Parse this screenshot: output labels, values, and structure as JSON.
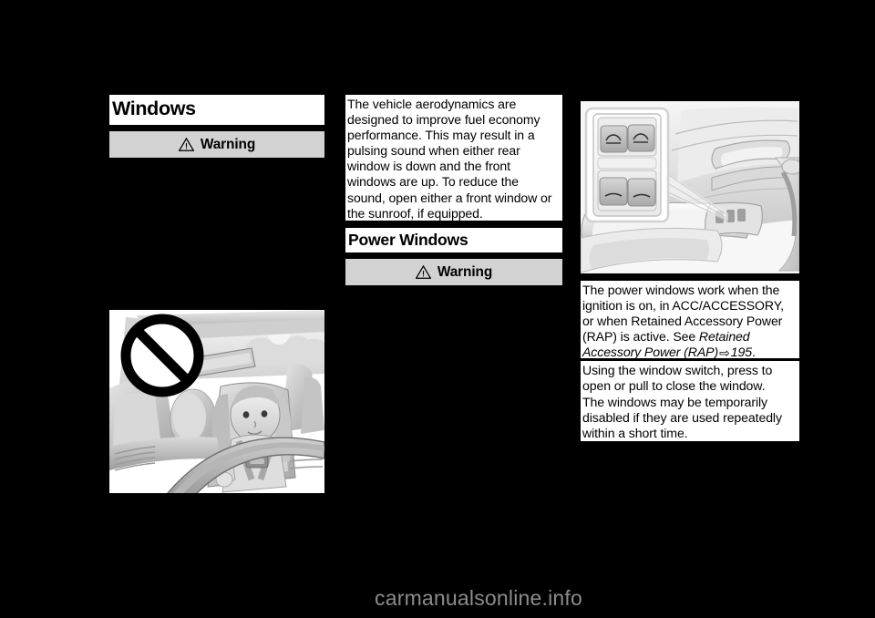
{
  "page": {
    "background_color": "#000000",
    "text_color": "#000000",
    "panel_color": "#ffffff",
    "warning_banner_color": "#d2d2d2",
    "footer_color": "#8c8c8c"
  },
  "left_column": {
    "section_title": "Windows",
    "warning_label": "Warning",
    "warning_icon": "warning-triangle-icon",
    "figure_caption": "",
    "figure_name": "child-in-car-seat-prohibited-illustration",
    "figure_alt": "Grayscale illustration of a vehicle interior showing a child seated in a child restraint in the front seat, overlaid with a circular prohibition (no) symbol"
  },
  "middle_column": {
    "paragraph": "The vehicle aerodynamics are designed to improve fuel economy performance. This may result in a pulsing sound when either rear window is down and the front windows are up. To reduce the sound, open either a front window or the sunroof, if equipped.",
    "section_title": "Power Windows",
    "warning_label": "Warning",
    "warning_icon": "warning-triangle-icon"
  },
  "right_column": {
    "figure_name": "driver-door-window-switch-illustration",
    "figure_alt": "Grayscale illustration of a driver door armrest panel with a magnified callout of the four power window switches",
    "blocks": [
      {
        "id": "rap-note",
        "text_before": "The power windows work when the ignition is on, in ACC/ACCESSORY, or when Retained Accessory Power (RAP) is active. See ",
        "reference_italic": "Retained Accessory Power (RAP)",
        "reference_arrow": "⇨",
        "reference_page": "195",
        "text_after": "."
      },
      {
        "id": "switch-usage",
        "text": "Using the window switch, press to open or pull to close the window."
      },
      {
        "id": "temporary-disable",
        "text": "The windows may be temporarily disabled if they are used repeatedly within a short time."
      }
    ]
  },
  "footer": {
    "watermark": "carmanualsonline.info"
  }
}
